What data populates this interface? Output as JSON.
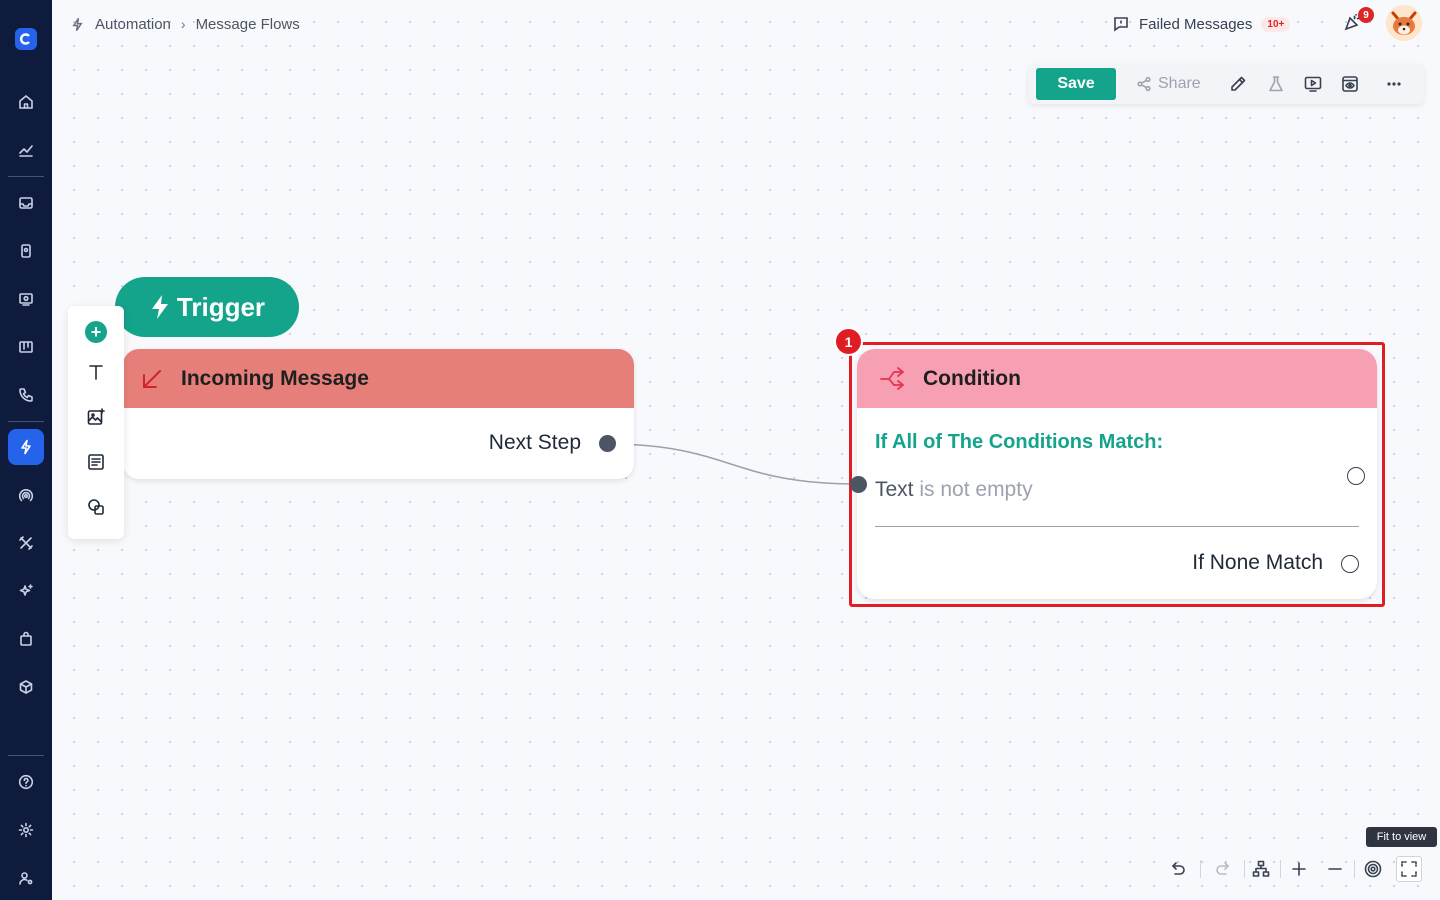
{
  "breadcrumb": {
    "root": "Automation",
    "current": "Message Flows"
  },
  "header": {
    "failed_label": "Failed Messages",
    "failed_badge": "10+",
    "notification_count": "9"
  },
  "toolbar": {
    "save_label": "Save",
    "share_label": "Share"
  },
  "colors": {
    "accent": "#14a38b",
    "sidebar": "#0f1b3d",
    "trigger_header": "#e67f79",
    "condition_header": "#f7a0b4",
    "highlight": "#e11d24"
  },
  "trigger": {
    "pill_label": "Trigger",
    "node_title": "Incoming Message",
    "next_step": "Next Step"
  },
  "condition": {
    "marker": "1",
    "title": "Condition",
    "match_all": "If All of The Conditions Match:",
    "rule_field": "Text",
    "rule_op": "is not empty",
    "none_match": "If None Match"
  },
  "controls": {
    "tooltip": "Fit to view"
  }
}
